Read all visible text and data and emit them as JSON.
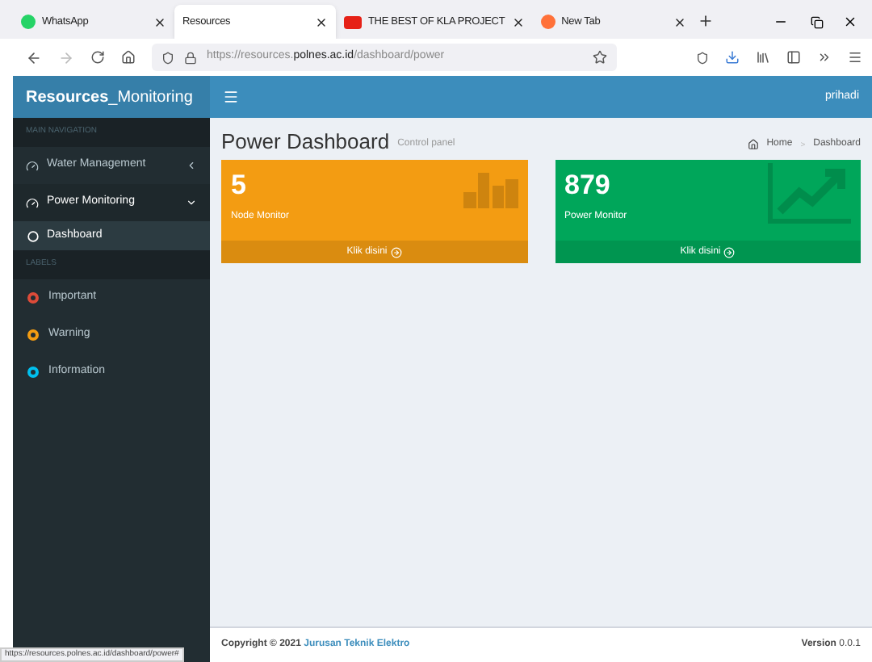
{
  "browser": {
    "tabs": [
      {
        "title": "WhatsApp",
        "selected": false,
        "kind": "chat"
      },
      {
        "title": "Resources",
        "selected": true,
        "kind": "plain"
      },
      {
        "title": "THE BEST OF KLA PROJECT",
        "selected": false,
        "kind": "video"
      },
      {
        "title": "New Tab",
        "selected": false,
        "kind": "fox"
      }
    ],
    "url": {
      "prefix": "https://resources.",
      "domain": "polnes.ac.id",
      "path": "/dashboard/power"
    },
    "status_url": "https://resources.polnes.ac.id/dashboard/power#"
  },
  "header": {
    "brand_bold": "Resources",
    "brand_rest": "_Monitoring",
    "user": "prihadi"
  },
  "sidebar": {
    "sections": [
      {
        "heading": "MAIN NAVIGATION",
        "items": [
          {
            "label": "Water Management",
            "kind": "menu",
            "expanded": false
          },
          {
            "label": "Power Monitoring",
            "kind": "menu",
            "expanded": true,
            "children": [
              {
                "label": "Dashboard",
                "selected": true
              }
            ]
          }
        ]
      },
      {
        "heading": "LABELS",
        "items": [
          {
            "label": "Important",
            "kind": "label",
            "color": "#dd4b39"
          },
          {
            "label": "Warning",
            "kind": "label",
            "color": "#f39c12"
          },
          {
            "label": "Information",
            "kind": "label",
            "color": "#00c0ef"
          }
        ]
      }
    ]
  },
  "content": {
    "title": "Power Dashboard",
    "subtitle": "Control panel",
    "breadcrumb": [
      "Home",
      "Dashboard"
    ],
    "breadcrumb_separator": ">",
    "boxes": [
      {
        "value": "5",
        "label": "Node Monitor",
        "link": "Klik disini",
        "color": "#f39c12",
        "kind": "bars"
      },
      {
        "value": "879",
        "label": "Power Monitor",
        "link": "Klik disini",
        "color": "#00a65a",
        "kind": "trend"
      }
    ]
  },
  "footer": {
    "copyright": "Copyright © 2021",
    "org": "Jurusan Teknik Elektro",
    "version_label": "Version",
    "version": "0.0.1"
  }
}
